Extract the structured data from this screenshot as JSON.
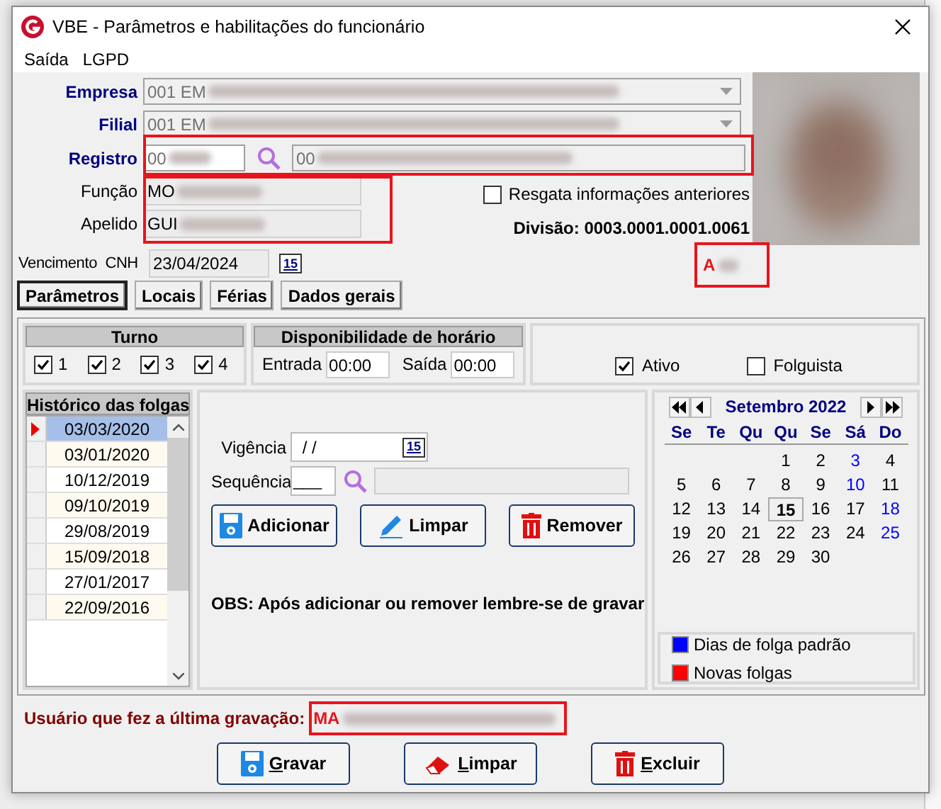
{
  "window": {
    "title": "VBE - Parâmetros e habilitações do funcionário"
  },
  "menu": [
    {
      "label": "Saída"
    },
    {
      "label": "LGPD"
    }
  ],
  "form": {
    "empresa": {
      "label": "Empresa",
      "value": "001 EM"
    },
    "filial": {
      "label": "Filial",
      "value": "001 EM"
    },
    "registro": {
      "label": "Registro",
      "code": "00",
      "name": "00"
    },
    "funcao": {
      "label": "Função",
      "value": "MO"
    },
    "apelido": {
      "label": "Apelido",
      "value": "GUI"
    },
    "resgata": {
      "label": "Resgata informações anteriores",
      "checked": false
    },
    "divisao": "Divisão: 0003.0001.0001.0061",
    "cnh": {
      "label": "Vencimento  CNH",
      "value": "23/04/2024",
      "calendar": "15"
    },
    "situacao": "A"
  },
  "tabs": [
    {
      "label": "Parâmetros",
      "selected": true
    },
    {
      "label": "Locais",
      "selected": false
    },
    {
      "label": "Férias",
      "selected": false
    },
    {
      "label": "Dados gerais",
      "selected": false
    }
  ],
  "turno": {
    "title": "Turno",
    "items": [
      {
        "label": "1",
        "checked": true
      },
      {
        "label": "2",
        "checked": true
      },
      {
        "label": "3",
        "checked": true
      },
      {
        "label": "4",
        "checked": true
      }
    ]
  },
  "disponibilidade": {
    "title": "Disponibilidade de horário",
    "entrada_label": "Entrada",
    "entrada": "00:00",
    "saida_label": "Saída",
    "saida": "00:00"
  },
  "flags": [
    {
      "label": "Ativo",
      "checked": true
    },
    {
      "label": "Folguista",
      "checked": false
    }
  ],
  "historico": {
    "title": "Histórico das folgas",
    "rows": [
      {
        "date": "03/03/2020",
        "selected": true
      },
      {
        "date": "03/01/2020",
        "selected": false
      },
      {
        "date": "10/12/2019",
        "selected": false
      },
      {
        "date": "09/10/2019",
        "selected": false
      },
      {
        "date": "29/08/2019",
        "selected": false
      },
      {
        "date": "15/09/2018",
        "selected": false
      },
      {
        "date": "27/01/2017",
        "selected": false
      },
      {
        "date": "22/09/2016",
        "selected": false
      }
    ]
  },
  "editor": {
    "vigencia_label": "Vigência",
    "vigencia": " / /",
    "calendar": "15",
    "sequencia_label": "Sequência",
    "sequencia": "___",
    "buttons": [
      {
        "label": "Adicionar",
        "kind": "save"
      },
      {
        "label": "Limpar",
        "kind": "pencil"
      },
      {
        "label": "Remover",
        "kind": "trash"
      }
    ],
    "note": "OBS: Após adicionar ou remover lembre-se de gravar"
  },
  "calendar": {
    "month": "Setembro 2022",
    "weekdays": [
      "Se",
      "Te",
      "Qu",
      "Qu",
      "Se",
      "Sá",
      "Do"
    ],
    "weeks": [
      [
        {
          "d": "1",
          "off": false,
          "selected": false
        },
        {
          "d": "2",
          "off": false,
          "selected": false
        },
        {
          "d": "3",
          "off": true,
          "selected": false
        },
        {
          "d": "4",
          "off": false,
          "selected": false
        }
      ],
      [
        {
          "d": "5",
          "off": false,
          "selected": false
        },
        {
          "d": "6",
          "off": false,
          "selected": false
        },
        {
          "d": "7",
          "off": false,
          "selected": false
        },
        {
          "d": "8",
          "off": false,
          "selected": false
        },
        {
          "d": "9",
          "off": false,
          "selected": false
        },
        {
          "d": "10",
          "off": true,
          "selected": false
        },
        {
          "d": "11",
          "off": false,
          "selected": false
        }
      ],
      [
        {
          "d": "12",
          "off": false,
          "selected": false
        },
        {
          "d": "13",
          "off": false,
          "selected": false
        },
        {
          "d": "14",
          "off": false,
          "selected": false
        },
        {
          "d": "15",
          "off": false,
          "selected": true
        },
        {
          "d": "16",
          "off": false,
          "selected": false
        },
        {
          "d": "17",
          "off": false,
          "selected": false
        },
        {
          "d": "18",
          "off": true,
          "selected": false
        }
      ],
      [
        {
          "d": "19",
          "off": false,
          "selected": false
        },
        {
          "d": "20",
          "off": false,
          "selected": false
        },
        {
          "d": "21",
          "off": false,
          "selected": false
        },
        {
          "d": "22",
          "off": false,
          "selected": false
        },
        {
          "d": "23",
          "off": false,
          "selected": false
        },
        {
          "d": "24",
          "off": false,
          "selected": false
        },
        {
          "d": "25",
          "off": true,
          "selected": false
        }
      ],
      [
        {
          "d": "26",
          "off": false,
          "selected": false
        },
        {
          "d": "27",
          "off": false,
          "selected": false
        },
        {
          "d": "28",
          "off": false,
          "selected": false
        },
        {
          "d": "29",
          "off": false,
          "selected": false
        },
        {
          "d": "30",
          "off": false,
          "selected": false
        }
      ]
    ],
    "legend": [
      {
        "label": "Dias de folga padrão",
        "color": "#0000ff"
      },
      {
        "label": "Novas folgas",
        "color": "#ff0000"
      }
    ]
  },
  "last_user": {
    "label": "Usuário que fez a última gravação:",
    "value": "MA"
  },
  "actions": [
    {
      "label": "Gravar",
      "kind": "save"
    },
    {
      "label": "Limpar",
      "kind": "eraser"
    },
    {
      "label": "Excluir",
      "kind": "trash"
    }
  ]
}
